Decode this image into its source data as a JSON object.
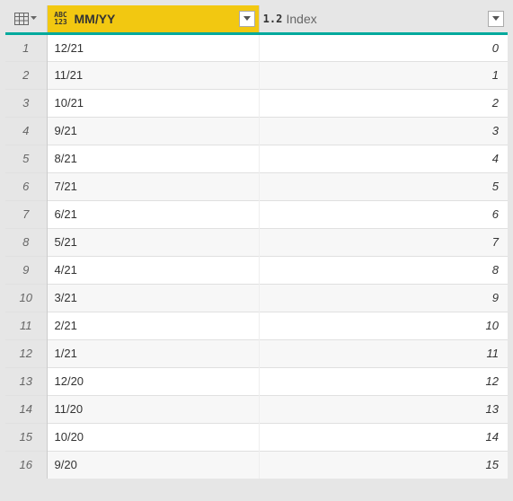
{
  "columns": [
    {
      "name": "MM/YY",
      "type_icon_lines": [
        "ABC",
        "123"
      ],
      "highlighted": true
    },
    {
      "name": "Index",
      "type_icon_lines": [
        "1.2"
      ],
      "highlighted": false
    }
  ],
  "rows": [
    {
      "n": "1",
      "mmYY": "12/21",
      "index": "0"
    },
    {
      "n": "2",
      "mmYY": "11/21",
      "index": "1"
    },
    {
      "n": "3",
      "mmYY": "10/21",
      "index": "2"
    },
    {
      "n": "4",
      "mmYY": "9/21",
      "index": "3"
    },
    {
      "n": "5",
      "mmYY": "8/21",
      "index": "4"
    },
    {
      "n": "6",
      "mmYY": "7/21",
      "index": "5"
    },
    {
      "n": "7",
      "mmYY": "6/21",
      "index": "6"
    },
    {
      "n": "8",
      "mmYY": "5/21",
      "index": "7"
    },
    {
      "n": "9",
      "mmYY": "4/21",
      "index": "8"
    },
    {
      "n": "10",
      "mmYY": "3/21",
      "index": "9"
    },
    {
      "n": "11",
      "mmYY": "2/21",
      "index": "10"
    },
    {
      "n": "12",
      "mmYY": "1/21",
      "index": "11"
    },
    {
      "n": "13",
      "mmYY": "12/20",
      "index": "12"
    },
    {
      "n": "14",
      "mmYY": "11/20",
      "index": "13"
    },
    {
      "n": "15",
      "mmYY": "10/20",
      "index": "14"
    },
    {
      "n": "16",
      "mmYY": "9/20",
      "index": "15"
    }
  ]
}
